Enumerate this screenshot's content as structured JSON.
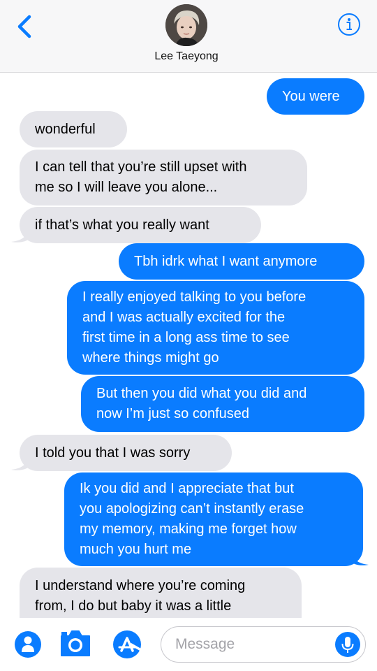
{
  "header": {
    "contact_name": "Lee Taeyong"
  },
  "messages": [
    {
      "from": "me",
      "text": "You were"
    },
    {
      "from": "them",
      "text": "wonderful"
    },
    {
      "from": "them",
      "lines": [
        "I can tell that you’re still upset with",
        "me so I will leave you alone..."
      ]
    },
    {
      "from": "them",
      "text": "if that’s what you really want"
    },
    {
      "from": "me",
      "text": "Tbh idrk what I want anymore"
    },
    {
      "from": "me",
      "lines": [
        "I really enjoyed talking to you before",
        "and I was actually excited for the",
        "first time in a long ass time to see",
        "where things might go"
      ]
    },
    {
      "from": "me",
      "lines": [
        "But then you did what you did and",
        "now I’m just so confused"
      ]
    },
    {
      "from": "them",
      "text": "I told you that I was sorry"
    },
    {
      "from": "me",
      "lines": [
        "Ik you did and I appreciate that but",
        "you apologizing can’t instantly erase",
        "my memory, making  me forget how",
        "much you hurt me"
      ]
    },
    {
      "from": "them",
      "lines": [
        "I understand where you’re coming",
        "from, I do but baby it was a little"
      ]
    }
  ],
  "composer": {
    "placeholder": "Message"
  },
  "colors": {
    "accent": "#0a7cff",
    "incoming_bubble": "#e5e5ea",
    "header_bg": "#f7f7f8"
  },
  "icons": [
    "back-chevron-icon",
    "info-icon",
    "appstore-icon",
    "camera-icon",
    "apps-icon",
    "microphone-icon"
  ]
}
